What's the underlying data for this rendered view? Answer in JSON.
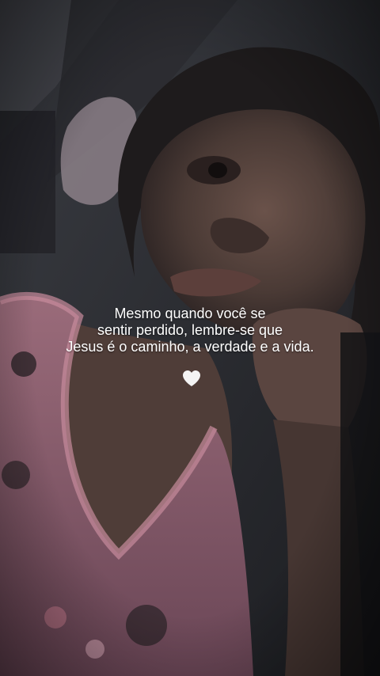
{
  "caption": {
    "lines": [
      "Mesmo quando você se",
      "sentir perdido, lembre-se que",
      "Jesus é o caminho, a verdade e a vida."
    ],
    "text_color": "#ffffff"
  },
  "heart": {
    "icon": "white-heart-icon",
    "color": "#f4f4f4"
  },
  "colors": {
    "background": "#141416",
    "skin": "#5a4640",
    "shirt_pink": "#8a5f6e"
  }
}
